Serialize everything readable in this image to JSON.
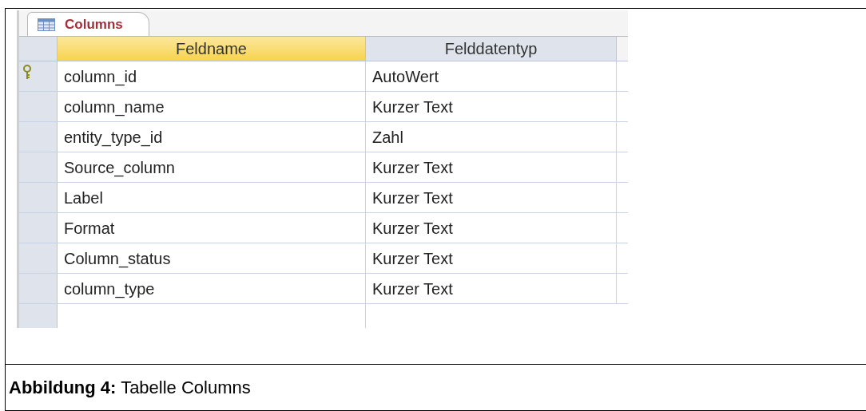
{
  "tab": {
    "label": "Columns"
  },
  "table": {
    "columns": [
      "Feldname",
      "Felddatentyp"
    ],
    "rows": [
      {
        "primary_key": true,
        "cells": [
          "column_id",
          "AutoWert"
        ]
      },
      {
        "primary_key": false,
        "cells": [
          "column_name",
          "Kurzer Text"
        ]
      },
      {
        "primary_key": false,
        "cells": [
          "entity_type_id",
          "Zahl"
        ]
      },
      {
        "primary_key": false,
        "cells": [
          "Source_column",
          "Kurzer Text"
        ]
      },
      {
        "primary_key": false,
        "cells": [
          "Label",
          "Kurzer Text"
        ]
      },
      {
        "primary_key": false,
        "cells": [
          "Format",
          "Kurzer Text"
        ]
      },
      {
        "primary_key": false,
        "cells": [
          "Column_status",
          "Kurzer Text"
        ]
      },
      {
        "primary_key": false,
        "cells": [
          "column_type",
          "Kurzer Text"
        ]
      }
    ]
  },
  "caption": "**Abbildung 4:** Tabelle Columns"
}
